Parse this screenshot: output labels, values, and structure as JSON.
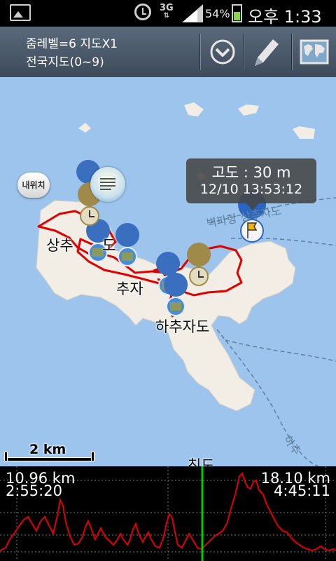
{
  "status_bar": {
    "network": "3G",
    "battery_percent": "54%",
    "time": "오후 1:33"
  },
  "toolbar": {
    "zoom_info": "줌레벨=6 지도X1",
    "map_name": "전국지도(0~9)",
    "buttons": [
      {
        "icon": "chevron-down-circle-icon"
      },
      {
        "icon": "pencil-icon"
      },
      {
        "icon": "world-map-icon"
      }
    ]
  },
  "map": {
    "my_location_button": "내위치",
    "tooltip": {
      "altitude": "고도 : 30 m",
      "datetime": "12/10 13:53:12"
    },
    "labels": {
      "island_1": "상추",
      "island_1_suffix": "도",
      "island_2": "추자",
      "island_3": "하추자도",
      "bottom": "칙도",
      "route_1": "벽파항 상추자도",
      "route_2": "하추"
    },
    "scale_label": "2 km",
    "colors": {
      "sea": "#9cc4ec",
      "land": "#f2eee6",
      "track": "#e00000"
    }
  },
  "profile": {
    "left_distance": "10.96 km",
    "left_time": "2:55:20",
    "right_distance": "18.10 km",
    "right_time": "4:45:11",
    "cursor_color": "#00d000",
    "line_color": "#e00000"
  }
}
